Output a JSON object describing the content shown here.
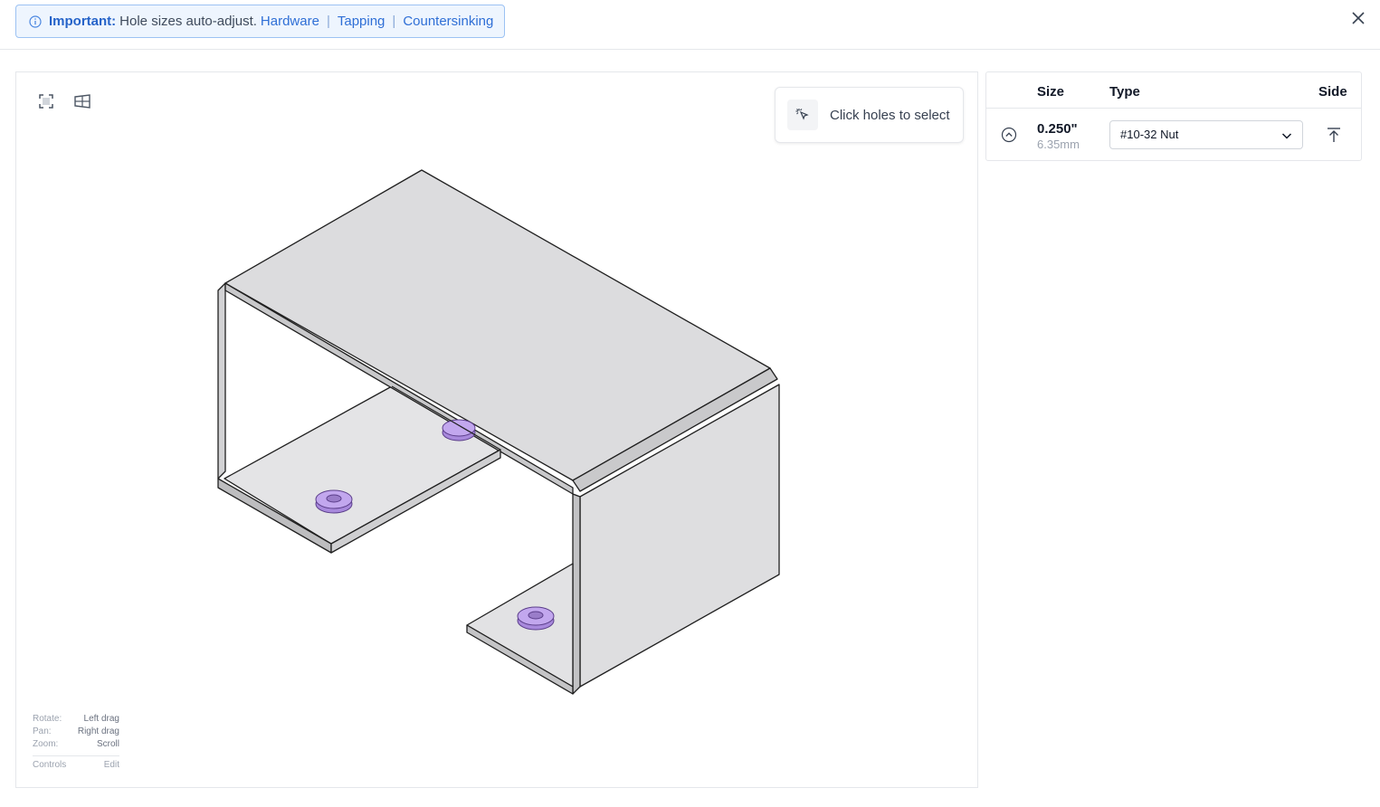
{
  "notice": {
    "label": "Important:",
    "message": "Hole sizes auto-adjust.",
    "links": [
      "Hardware",
      "Tapping",
      "Countersinking"
    ],
    "color": "#2f6fd6"
  },
  "viewer": {
    "hint": "Click holes to select",
    "controls": [
      {
        "label": "Rotate:",
        "value": "Left drag"
      },
      {
        "label": "Pan:",
        "value": "Right drag"
      },
      {
        "label": "Zoom:",
        "value": "Scroll"
      }
    ],
    "controls_title": "Controls",
    "controls_edit": "Edit",
    "hole_color": "#b89ae6"
  },
  "table": {
    "headers": {
      "size": "Size",
      "type": "Type",
      "side": "Side"
    },
    "rows": [
      {
        "size_in": "0.250\"",
        "size_mm": "6.35mm",
        "type": "#10-32 Nut"
      }
    ]
  },
  "icons": {
    "info": "info-icon",
    "close": "close-icon",
    "fit": "fit-view-icon",
    "perspective": "perspective-icon",
    "cursor": "cursor-click-icon",
    "expand": "chevron-up-circle-icon",
    "dropdown": "chevron-down-icon",
    "side": "arrow-up-to-line-icon"
  }
}
